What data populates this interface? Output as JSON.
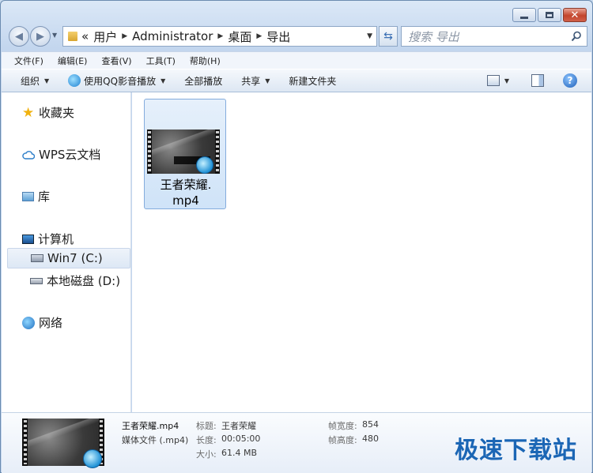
{
  "window": {
    "caption": {
      "minimize": "",
      "maximize": "",
      "close": "✕"
    }
  },
  "address": {
    "prefix": "«",
    "crumbs": [
      "用户",
      "Administrator",
      "桌面",
      "导出"
    ]
  },
  "search": {
    "placeholder": "搜索 导出"
  },
  "menu": [
    "文件(F)",
    "编辑(E)",
    "查看(V)",
    "工具(T)",
    "帮助(H)"
  ],
  "toolbar": {
    "organize": "组织",
    "play_qq": "使用QQ影音播放",
    "play_all": "全部播放",
    "share": "共享",
    "new_folder": "新建文件夹"
  },
  "nav": {
    "favorites": "收藏夹",
    "wps_cloud": "WPS云文档",
    "libraries": "库",
    "computer": "计算机",
    "drive_c": "Win7 (C:)",
    "drive_d": "本地磁盘 (D:)",
    "network": "网络"
  },
  "file": {
    "name_line1": "王者荣耀.",
    "name_line2": "mp4"
  },
  "details": {
    "filename": "王者荣耀.mp4",
    "filetype": "媒体文件 (.mp4)",
    "title_label": "标题:",
    "title_value": "王者荣耀",
    "length_label": "长度:",
    "length_value": "00:05:00",
    "size_label": "大小:",
    "size_value": "61.4 MB",
    "frame_width_label": "帧宽度:",
    "frame_width_value": "854",
    "frame_height_label": "帧高度:",
    "frame_height_value": "480"
  },
  "watermark": "极速下载站"
}
